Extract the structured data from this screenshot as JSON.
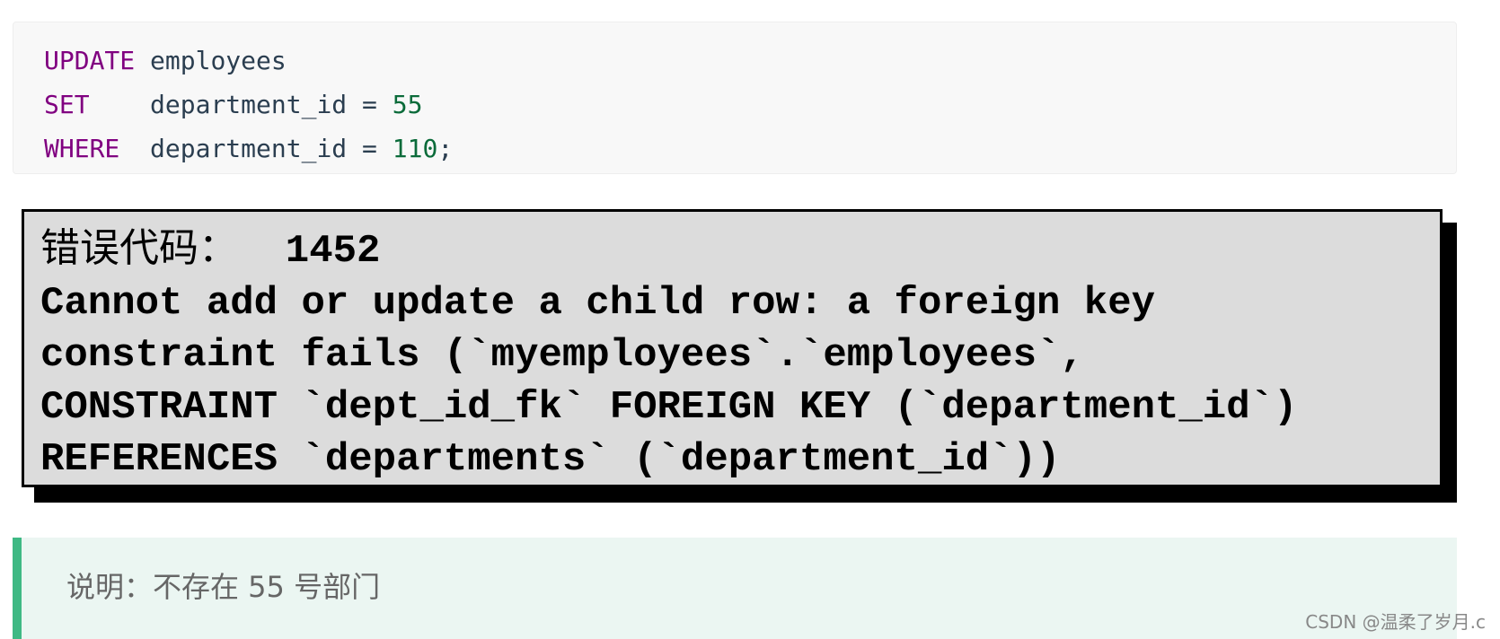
{
  "code": {
    "lines": [
      {
        "keyword": "UPDATE",
        "pad": " ",
        "rest": "employees",
        "num": "",
        "end": ""
      },
      {
        "keyword": "SET",
        "pad": "    ",
        "rest": "department_id = ",
        "num": "55",
        "end": ""
      },
      {
        "keyword": "WHERE",
        "pad": "  ",
        "rest": "department_id = ",
        "num": "110",
        "end": ";"
      }
    ]
  },
  "error": {
    "label": "错误代码：",
    "code": "  1452",
    "lines": [
      "Cannot add or update a child row: a foreign key",
      "constraint fails (`myemployees`.`employees`,",
      "CONSTRAINT `dept_id_fk` FOREIGN KEY (`department_id`)",
      "REFERENCES `departments` (`department_id`))"
    ]
  },
  "note": {
    "text": "说明：不存在 55 号部门",
    "accent": "#3fb984"
  },
  "watermark": "CSDN @温柔了岁月.c"
}
